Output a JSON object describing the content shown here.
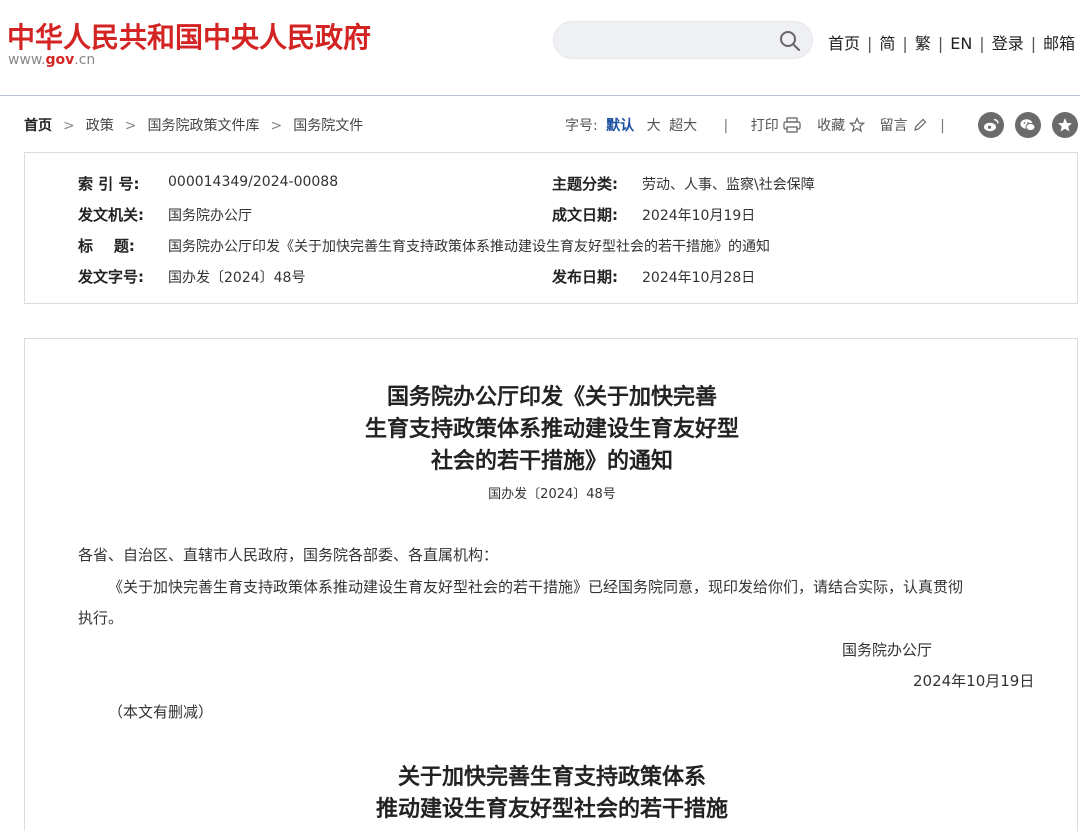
{
  "header": {
    "site_title": "中华人民共和国中央人民政府",
    "url_prefix": "www.",
    "url_gov": "gov",
    "url_suffix": ".cn",
    "search_placeholder": "",
    "nav": [
      "首页",
      "简",
      "繁",
      "EN",
      "登录",
      "邮箱"
    ],
    "nav_sep": "|"
  },
  "breadcrumb": {
    "items": [
      "首页",
      "政策",
      "国务院政策文件库",
      "国务院文件"
    ],
    "arrow": ">"
  },
  "tools": {
    "font_label": "字号:",
    "font_default": "默认",
    "font_large": "大",
    "font_xlarge": "超大",
    "separator": "|",
    "print": "打印",
    "favorite": "收藏",
    "comment": "留言"
  },
  "info": {
    "index_label": "索 引 号:",
    "index_value": "000014349/2024-00088",
    "topic_label": "主题分类:",
    "topic_value": "劳动、人事、监察\\社会保障",
    "issuer_label": "发文机关:",
    "issuer_value": "国务院办公厅",
    "written_label": "成文日期:",
    "written_value": "2024年10月19日",
    "title_label": "标    题:",
    "title_value": "国务院办公厅印发《关于加快完善生育支持政策体系推动建设生育友好型社会的若干措施》的通知",
    "docno_label": "发文字号:",
    "docno_value": "国办发〔2024〕48号",
    "publish_label": "发布日期:",
    "publish_value": "2024年10月28日"
  },
  "article": {
    "title_lines": [
      "国务院办公厅印发《关于加快完善",
      "生育支持政策体系推动建设生育友好型",
      "社会的若干措施》的通知"
    ],
    "doc_number": "国办发〔2024〕48号",
    "salutation": "各省、自治区、直辖市人民政府，国务院各部委、各直属机构：",
    "body_line1": "《关于加快完善生育支持政策体系推动建设生育友好型社会的若干措施》已经国务院同意，现印发给你们，请结合实际，认真贯彻",
    "body_line2": "执行。",
    "signer": "国务院办公厅",
    "sign_date": "2024年10月19日",
    "note": "（本文有删减）",
    "sub_title_lines": [
      "关于加快完善生育支持政策体系",
      "推动建设生育友好型社会的若干措施"
    ]
  }
}
